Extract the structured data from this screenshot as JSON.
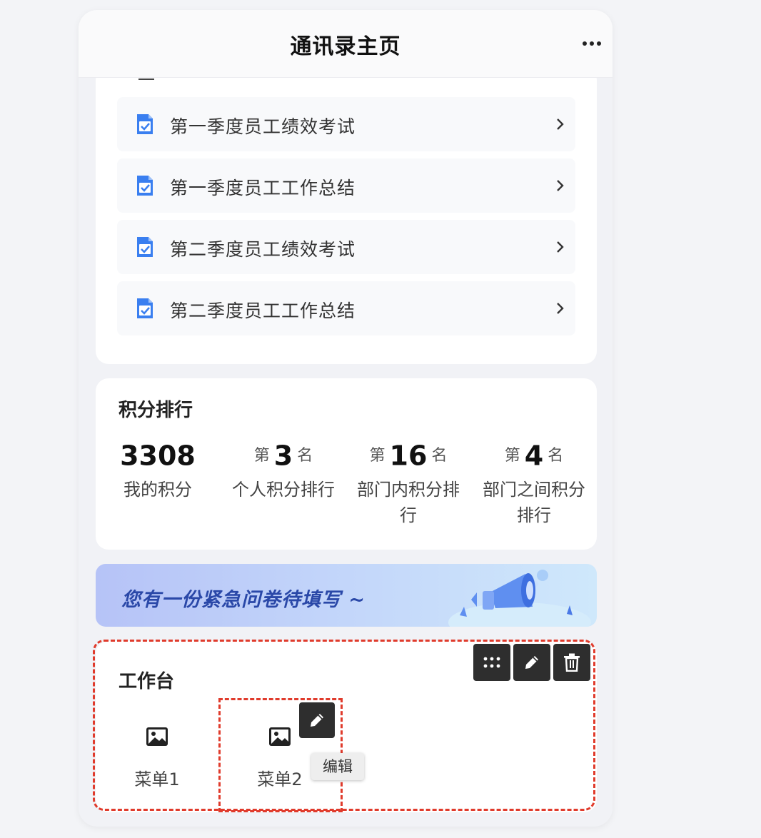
{
  "header": {
    "title": "通讯录主页",
    "more_icon": "ellipsis-icon"
  },
  "exams": {
    "items": [
      {
        "label": "第一季度员工绩效考试",
        "icon": "document-check-icon"
      },
      {
        "label": "第一季度员工工作总结",
        "icon": "document-check-icon"
      },
      {
        "label": "第二季度员工绩效考试",
        "icon": "document-check-icon"
      },
      {
        "label": "第二季度员工工作总结",
        "icon": "document-check-icon"
      }
    ]
  },
  "ranking": {
    "title": "积分排行",
    "stats": [
      {
        "prefix": "",
        "value": "3308",
        "suffix": "",
        "label": "我的积分"
      },
      {
        "prefix": "第",
        "value": "3",
        "suffix": "名",
        "label": "个人积分排行"
      },
      {
        "prefix": "第",
        "value": "16",
        "suffix": "名",
        "label": "部门内积分排行"
      },
      {
        "prefix": "第",
        "value": "4",
        "suffix": "名",
        "label": "部门之间积分排行"
      }
    ]
  },
  "banner": {
    "text": "您有一份紧急问卷待填写 ~",
    "icon": "megaphone-icon"
  },
  "workbench": {
    "title": "工作台",
    "menus": [
      {
        "label": "菜单1",
        "icon": "image-icon"
      },
      {
        "label": "菜单2",
        "icon": "image-icon"
      }
    ],
    "toolbar": [
      "drag-handle-icon",
      "pencil-icon",
      "trash-icon"
    ],
    "tooltip": "编辑"
  },
  "colors": {
    "accent_blue": "#3a7ff0",
    "highlight_red": "#e03b2c",
    "banner_text": "#2a48a8"
  }
}
